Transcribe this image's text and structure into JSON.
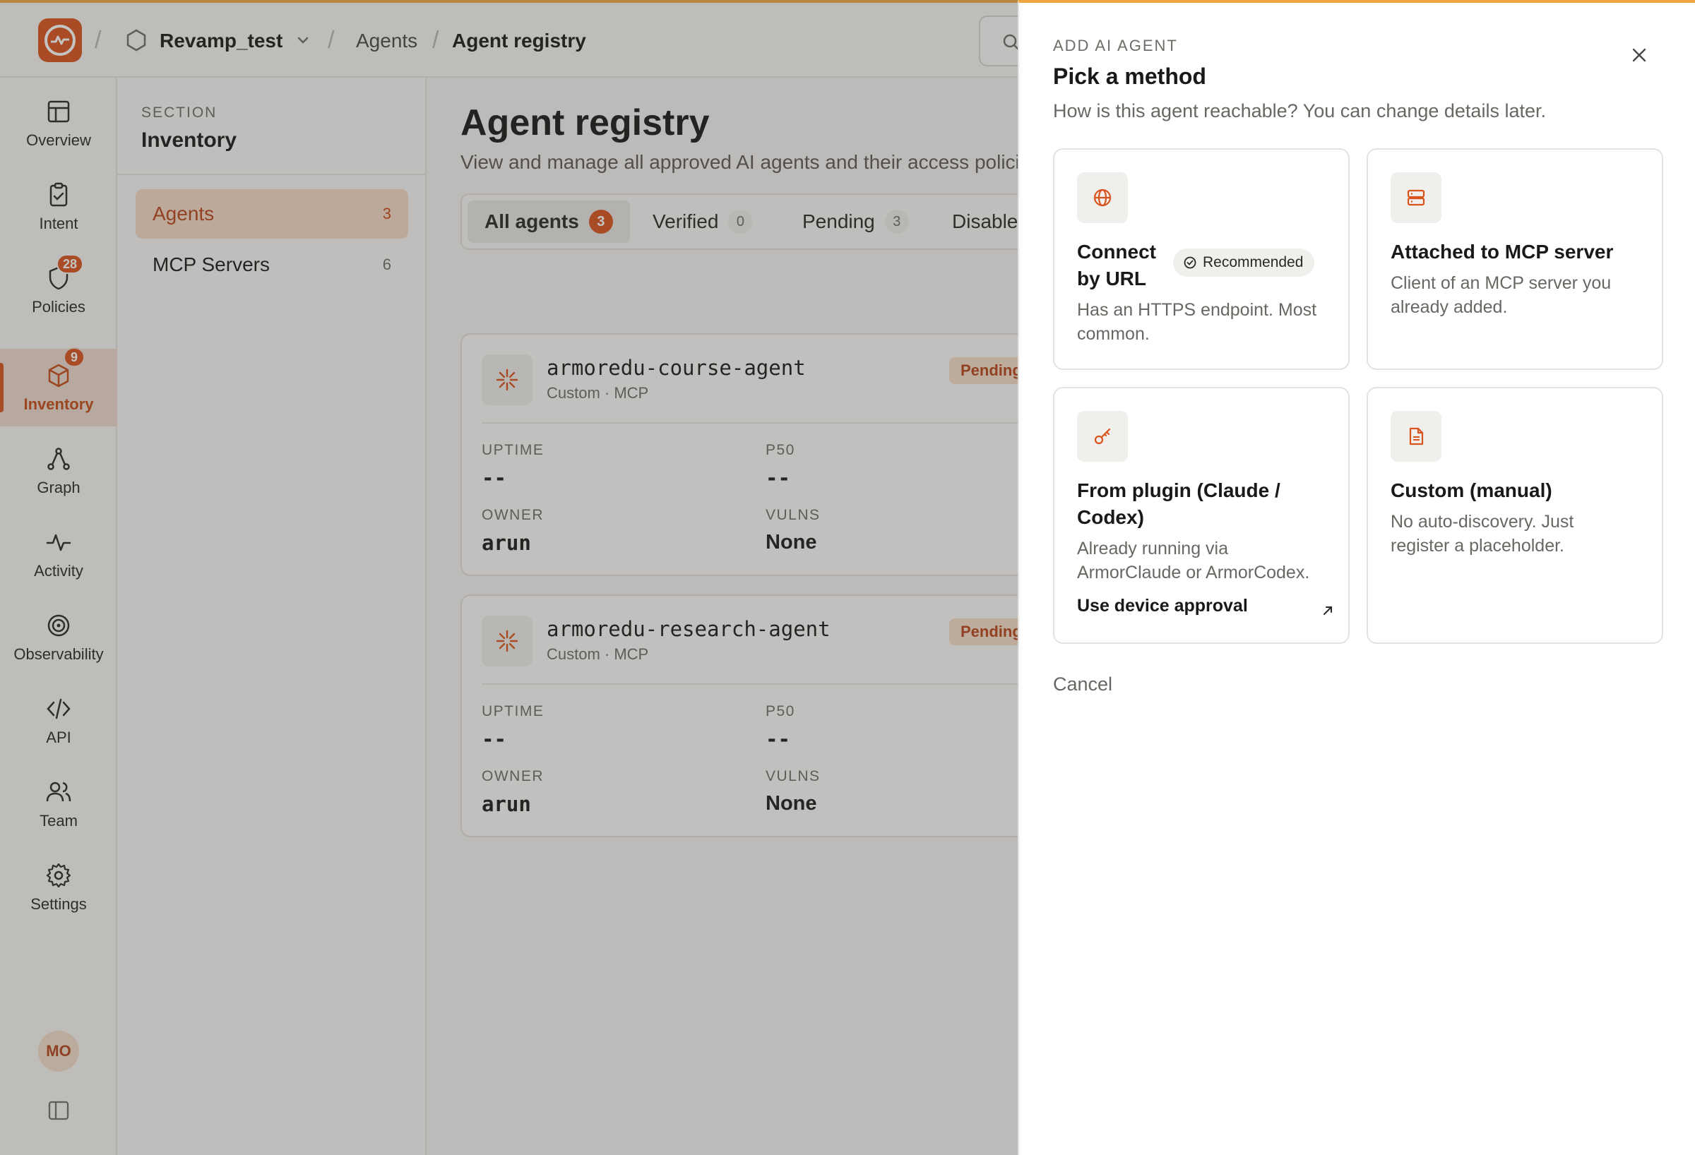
{
  "topbar": {
    "workspace": "Revamp_test",
    "breadcrumb": [
      "Agents",
      "Agent registry"
    ]
  },
  "rail": {
    "items": [
      {
        "label": "Overview",
        "icon": "layout-icon"
      },
      {
        "label": "Intent",
        "icon": "clipboard-check-icon"
      },
      {
        "label": "Policies",
        "icon": "shield-icon",
        "badge": "28"
      },
      {
        "label": "Inventory",
        "icon": "package-icon",
        "badge": "9",
        "active": true
      },
      {
        "label": "Graph",
        "icon": "graph-icon"
      },
      {
        "label": "Activity",
        "icon": "activity-icon"
      },
      {
        "label": "Observability",
        "icon": "target-icon"
      },
      {
        "label": "API",
        "icon": "code-icon"
      },
      {
        "label": "Team",
        "icon": "users-icon"
      },
      {
        "label": "Settings",
        "icon": "gear-icon"
      }
    ],
    "avatar_initials": "MO"
  },
  "section": {
    "eyebrow": "SECTION",
    "title": "Inventory",
    "items": [
      {
        "label": "Agents",
        "count": "3"
      },
      {
        "label": "MCP Servers",
        "count": "6"
      }
    ]
  },
  "main": {
    "title": "Agent registry",
    "subtitle": "View and manage all approved AI agents and their access policie",
    "tabs": [
      {
        "label": "All agents",
        "count": "3"
      },
      {
        "label": "Verified",
        "count": "0"
      },
      {
        "label": "Pending",
        "count": "3"
      },
      {
        "label": "Disable",
        "count": ""
      }
    ],
    "agents": [
      {
        "name": "armoredu-course-agent",
        "meta": "Custom · MCP",
        "status": "Pending",
        "uptime_label": "UPTIME",
        "uptime": "--",
        "p50_label": "P50",
        "p50": "--",
        "owner_label": "OWNER",
        "owner": "arun",
        "vulns_label": "VULNS",
        "vulns": "None"
      },
      {
        "name": "armoredu-research-agent",
        "meta": "Custom · MCP",
        "status": "Pending",
        "uptime_label": "UPTIME",
        "uptime": "--",
        "p50_label": "P50",
        "p50": "--",
        "owner_label": "OWNER",
        "owner": "arun",
        "vulns_label": "VULNS",
        "vulns": "None"
      }
    ]
  },
  "drawer": {
    "eyebrow": "ADD AI AGENT",
    "title": "Pick a method",
    "subtitle": "How is this agent reachable? You can change details later.",
    "options": [
      {
        "title_line1": "Connect",
        "title_line2": "by URL",
        "badge": "Recommended",
        "desc_line1": "Has an HTTPS endpoint. Most",
        "desc_line2": "common.",
        "icon": "globe-icon"
      },
      {
        "title": "Attached to MCP server",
        "desc_line1": "Client of an MCP server you",
        "desc_line2": "already added.",
        "icon": "server-icon"
      },
      {
        "title_line1": "From plugin (Claude /",
        "title_line2": "Codex)",
        "desc_line1": "Already running via",
        "desc_line2": "ArmorClaude or ArmorCodex.",
        "link": "Use device approval",
        "icon": "key-icon"
      },
      {
        "title": "Custom (manual)",
        "desc_line1": "No auto-discovery. Just",
        "desc_line2": "register a placeholder.",
        "icon": "file-icon"
      }
    ],
    "cancel": "Cancel"
  },
  "colors": {
    "accent": "#d9531e",
    "top_accent": "#f0a640"
  }
}
